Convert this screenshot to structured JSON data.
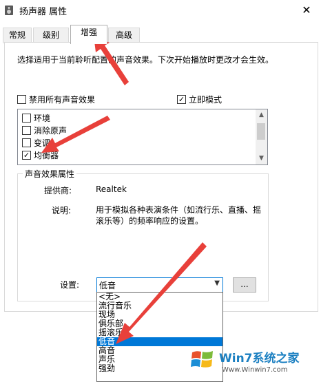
{
  "window": {
    "title": "扬声器 属性",
    "close": "✕"
  },
  "tabs": [
    {
      "label": "常规"
    },
    {
      "label": "级别"
    },
    {
      "label": "增强"
    },
    {
      "label": "高级"
    }
  ],
  "description": "选择适用于当前聆听配置的声音效果。下次开始播放时更改才会生效。",
  "disable_all": {
    "label": "禁用所有声音效果",
    "checked": false
  },
  "immediate_mode": {
    "label": "立即模式",
    "checked": true
  },
  "effects": [
    {
      "label": "环境",
      "checked": false
    },
    {
      "label": "消除原声",
      "checked": false
    },
    {
      "label": "变调",
      "checked": false
    },
    {
      "label": "均衡器",
      "checked": true
    }
  ],
  "properties": {
    "group_title": "声音效果属性",
    "provider_label": "提供商:",
    "provider_value": "Realtek",
    "desc_label": "说明:",
    "desc_value": "用于模拟各种表演条件（如流行乐、直播、摇滚乐等）的频率响应的设置。",
    "setting_label": "设置:",
    "setting_value": "低音",
    "more_button": "..."
  },
  "dropdown_options": [
    "<无>",
    "流行音乐",
    "现场",
    "俱乐部",
    "摇滚乐",
    "低音",
    "高音",
    "声乐",
    "强劲"
  ],
  "dropdown_selected": 5,
  "annotations": {
    "arrow_color": "#e8403a"
  },
  "watermark": {
    "brand": "Win7系统之家",
    "url": "Www.Winwin7.com"
  }
}
